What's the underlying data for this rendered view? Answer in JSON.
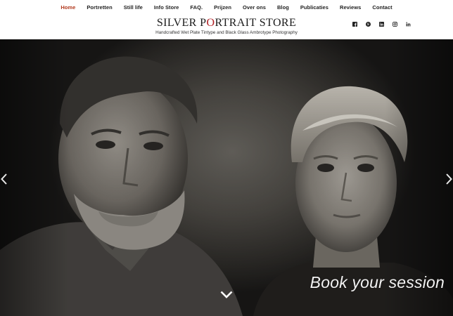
{
  "nav": {
    "items": [
      {
        "label": "Home",
        "active": true
      },
      {
        "label": "Portretten"
      },
      {
        "label": "Still life"
      },
      {
        "label": "Info Store"
      },
      {
        "label": "FAQ."
      },
      {
        "label": "Prijzen"
      },
      {
        "label": "Over ons"
      },
      {
        "label": "Blog"
      },
      {
        "label": "Publicaties"
      },
      {
        "label": "Reviews"
      },
      {
        "label": "Contact"
      }
    ]
  },
  "header": {
    "logo_part1": "SILVER P",
    "logo_accent": "O",
    "logo_part2": "RTRAIT STORE",
    "tagline": "Handcrafted Wet Plate Tintype and Black Glass Ambrotype Photography",
    "social_icons": [
      "facebook-icon",
      "pinterest-icon",
      "linkedin-icon",
      "instagram-icon",
      "linkedin-in-icon"
    ]
  },
  "hero": {
    "cta_label": "Book your session",
    "prev_icon": "chevron-left-icon",
    "next_icon": "chevron-right-icon",
    "down_icon": "chevron-down-icon"
  },
  "colors": {
    "accent": "#b11f24",
    "nav_active": "#b23a1f",
    "text": "#222222"
  }
}
